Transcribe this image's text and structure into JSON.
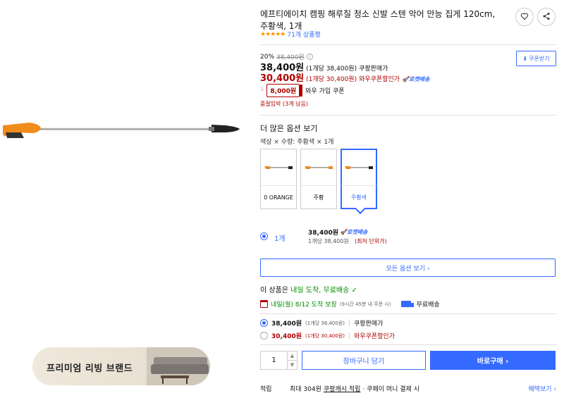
{
  "product": {
    "title": "에프티에이치 캠핑 해루질 청소 신발 스텐 악어 만능 집게 120cm, 주황색, 1개",
    "rating_stars": "★★★★★",
    "review_count": "71개 상품평"
  },
  "price": {
    "discount_rate": "20%",
    "original_price": "38,400원",
    "sale_price": "38,400원",
    "sale_unit": "(1개당 38,400원)",
    "sale_label": "쿠팡판매가",
    "wow_price": "30,400원",
    "wow_unit": "(1개당 30,400원)",
    "wow_label": "와우쿠폰할인가",
    "rocket_wow": "로켓배송",
    "coupon_button": "쿠폰받기",
    "wow_coupon_amount": "8,000원",
    "wow_coupon_text": "와우 가입 쿠폰",
    "low_stock": "품절임박 (3개 남음)"
  },
  "options": {
    "heading": "더 많은 옵션 보기",
    "selected_summary": "색상 × 수량: 주황색 × 1개",
    "tiles": [
      {
        "label": "0 ORANGE"
      },
      {
        "label": "주황"
      },
      {
        "label": "주황색"
      }
    ],
    "quantity_option": {
      "label": "1개",
      "price": "38,400원",
      "rocket": "로켓배송",
      "unit": "1개당 38,400원",
      "lowest": "(최저 단위가)"
    },
    "all_options_button": "모든 옵션 보기 ›"
  },
  "delivery": {
    "prefix": "이 상품은",
    "arrival_highlight": "내일 도착, 무료배송",
    "arrival_date": "내일(월) 8/12 도착 보장",
    "cutoff": "(9시간 45분 내 주문 시)",
    "shipping": "무료배송"
  },
  "sellers": [
    {
      "price": "38,400원",
      "unit": "(1개당 38,400원)",
      "label": "쿠팡판매가",
      "selected": true
    },
    {
      "price": "30,400원",
      "unit": "(1개당 30,400원)",
      "label": "와우쿠폰할인가",
      "selected": false
    }
  ],
  "cta": {
    "quantity": "1",
    "cart": "장바구니 담기",
    "buy": "바로구매 ›"
  },
  "reward": {
    "label": "적립",
    "max": "최대 304원",
    "cash": "쿠팡캐시 적립",
    "pay": "· 쿠페이 머니 결제 시",
    "benefit": "혜택보기 ›"
  },
  "banner": {
    "text": "프리미엄 리빙 브랜드"
  },
  "colors": {
    "accent": "#346aff",
    "red": "#ae0000",
    "green": "#008c00",
    "star": "#ff9600"
  }
}
